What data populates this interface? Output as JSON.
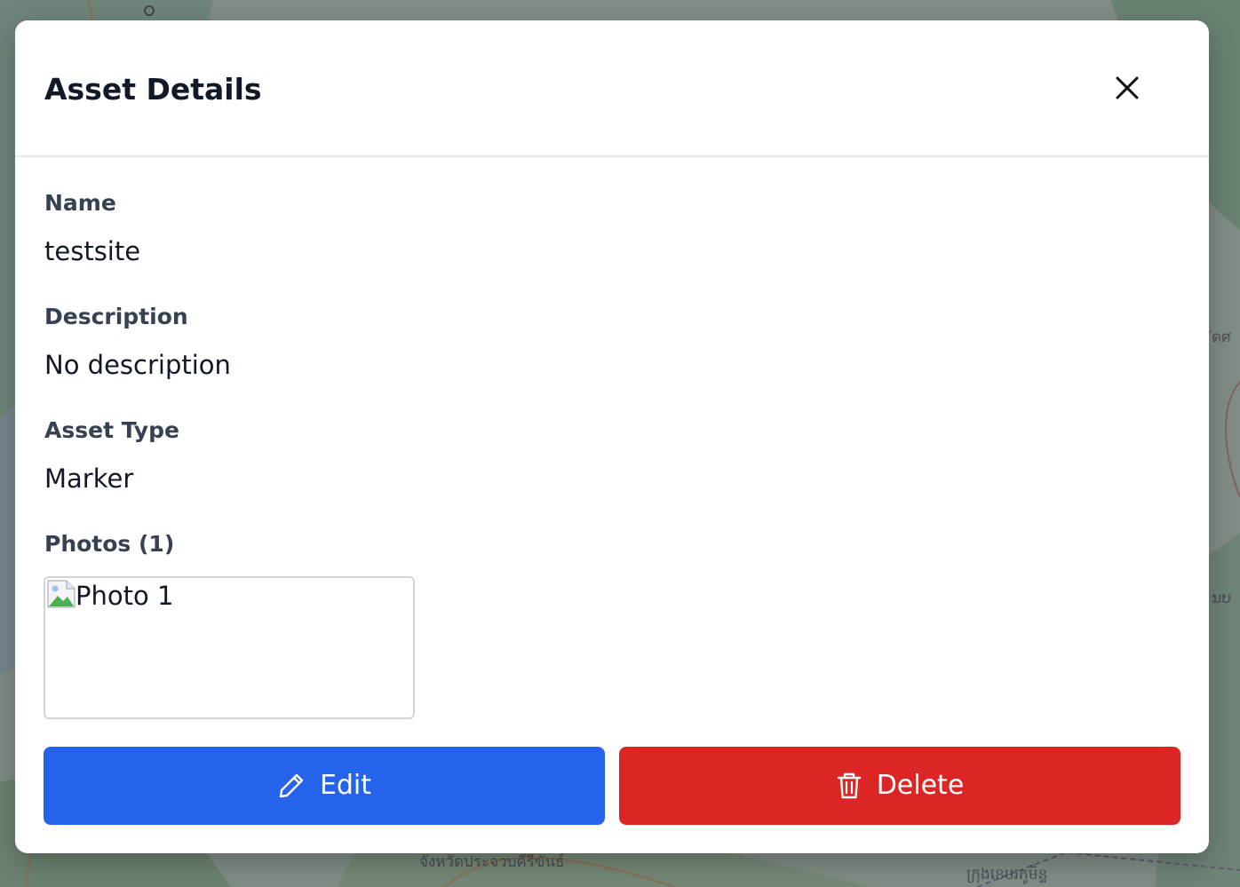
{
  "map": {
    "label_bottom_left": "จังหวัดประจวบคีรีขันธ์",
    "label_bottom_right": "ក្រុងខេមរភូមិន្ទ",
    "label_right_top": "ัดศ",
    "label_right_mid": "ນບ"
  },
  "modal": {
    "title": "Asset Details",
    "close_icon": "close-icon",
    "fields": {
      "name_label": "Name",
      "name_value": "testsite",
      "description_label": "Description",
      "description_value": "No description",
      "type_label": "Asset Type",
      "type_value": "Marker",
      "photos_label": "Photos (1)"
    },
    "photos": [
      {
        "alt": "Photo 1"
      }
    ],
    "actions": {
      "edit_label": "Edit",
      "edit_icon": "pencil-icon",
      "delete_label": "Delete",
      "delete_icon": "trash-icon"
    }
  },
  "colors": {
    "edit_button": "#2563eb",
    "delete_button": "#dc2626",
    "overlay": "#3a4448"
  }
}
